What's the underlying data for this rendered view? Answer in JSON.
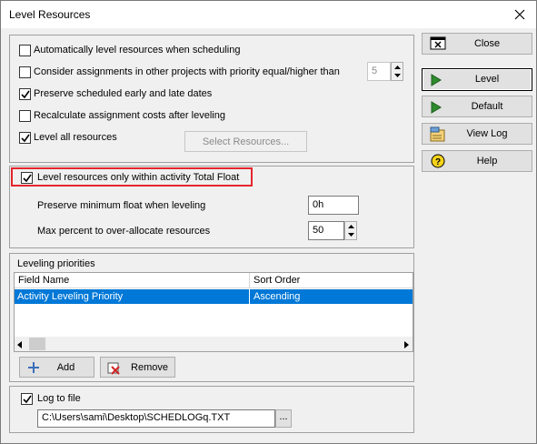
{
  "window": {
    "title": "Level Resources"
  },
  "options": [
    {
      "label": "Automatically level resources when scheduling",
      "checked": false
    },
    {
      "label": "Consider assignments in other projects with priority equal/higher than",
      "checked": false
    },
    {
      "label": "Preserve scheduled early and late dates",
      "checked": true
    },
    {
      "label": "Recalculate assignment costs after leveling",
      "checked": false
    },
    {
      "label": "Level all resources",
      "checked": true
    }
  ],
  "priority_value": "5",
  "select_resources_label": "Select Resources...",
  "total_float": {
    "label": "Level resources only within activity Total Float",
    "checked": true
  },
  "preserve_float": {
    "label": "Preserve minimum float when leveling",
    "value": "0h"
  },
  "max_percent": {
    "label": "Max percent to over-allocate resources",
    "value": "50"
  },
  "leveling_priorities": {
    "title": "Leveling priorities",
    "columns": [
      "Field Name",
      "Sort Order"
    ],
    "rows": [
      {
        "field": "Activity Leveling Priority",
        "order": "Ascending"
      }
    ]
  },
  "add_label": "Add",
  "remove_label": "Remove",
  "log": {
    "label": "Log to file",
    "checked": true,
    "path": "C:\\Users\\sami\\Desktop\\SCHEDLOGq.TXT",
    "browse": "..."
  },
  "side_buttons": {
    "close": "Close",
    "level": "Level",
    "default": "Default",
    "view_log": "View Log",
    "help": "Help"
  },
  "colors": {
    "highlight": "#e4262d",
    "selection": "#0078d7",
    "play_green": "#2e8b2e"
  },
  "icons": [
    "close-icon",
    "close-window-icon",
    "play-icon",
    "view-log-icon",
    "help-icon",
    "add-icon",
    "remove-icon",
    "spin-up-icon",
    "spin-down-icon",
    "scroll-left-icon",
    "scroll-right-icon"
  ]
}
